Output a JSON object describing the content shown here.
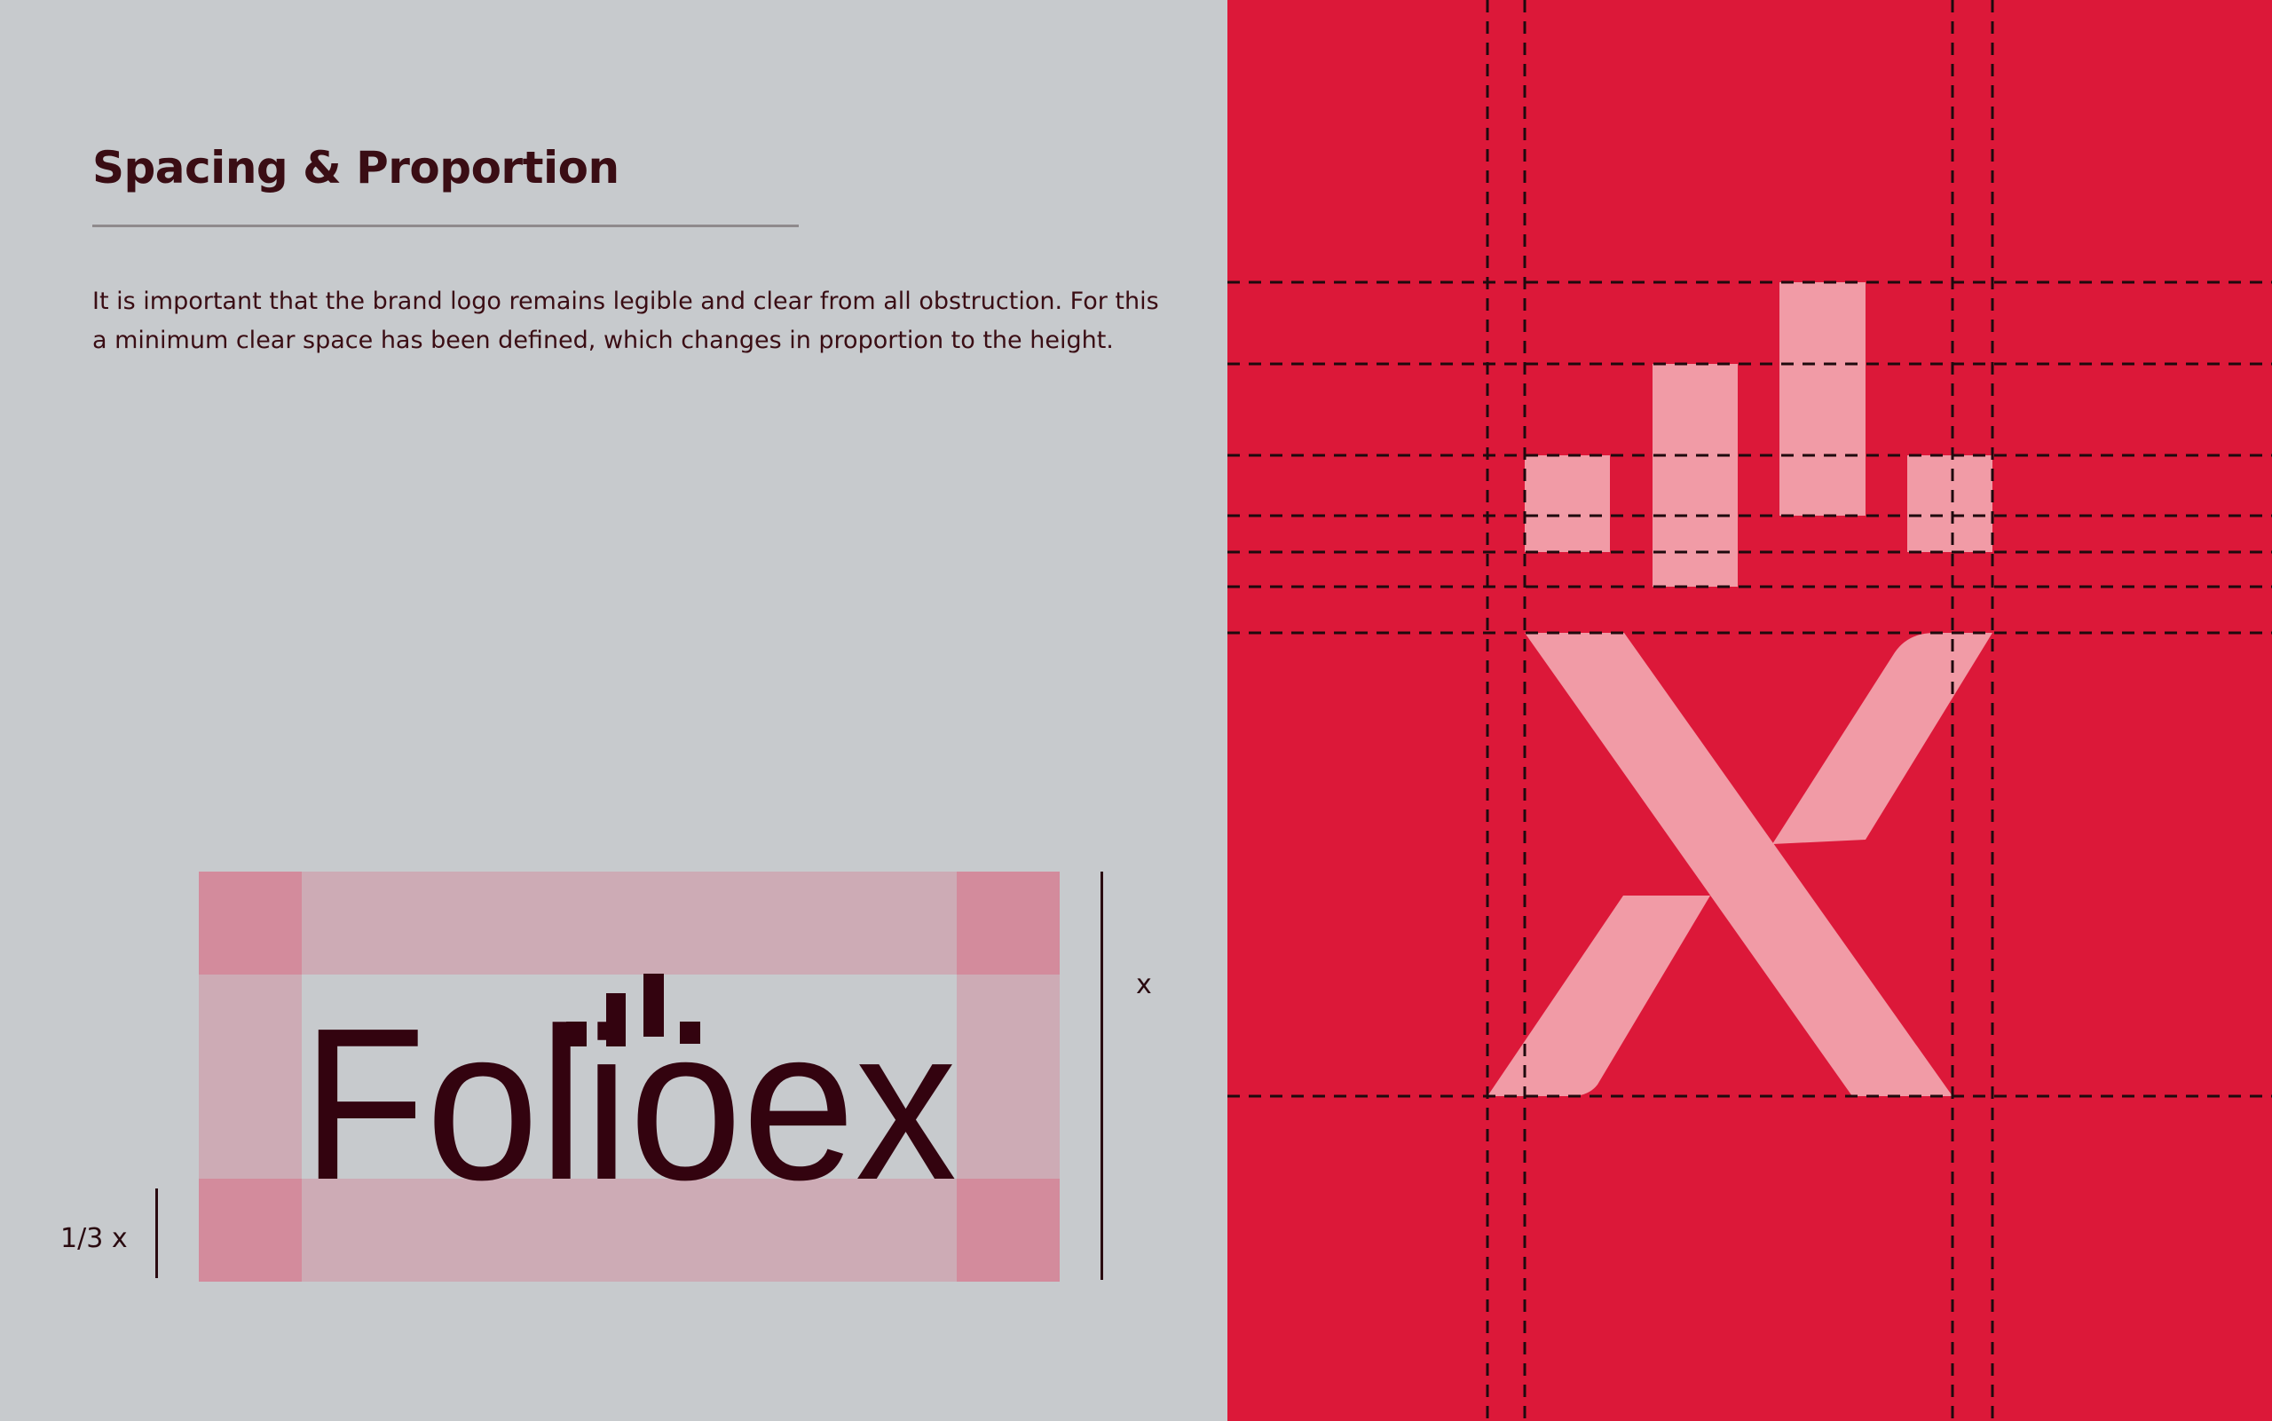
{
  "section": {
    "title": "Spacing & Proportion",
    "body_lines": [
      "It is important that the brand logo remains legible and clear from all obstruction. For this",
      "a minimum clear space has been defined, which changes in proportion to the height."
    ]
  },
  "logo": {
    "wordmark": "Folioex",
    "height_label": "x",
    "clearspace_label": "1/3 x"
  },
  "colors": {
    "left_background": "#c7cacd",
    "right_background": "#dc1839",
    "brand_dark": "#33030f",
    "mark_pink": "#f19ba6",
    "clearspace_band": "#cdabb5",
    "clearspace_corner": "#d38b9c"
  }
}
